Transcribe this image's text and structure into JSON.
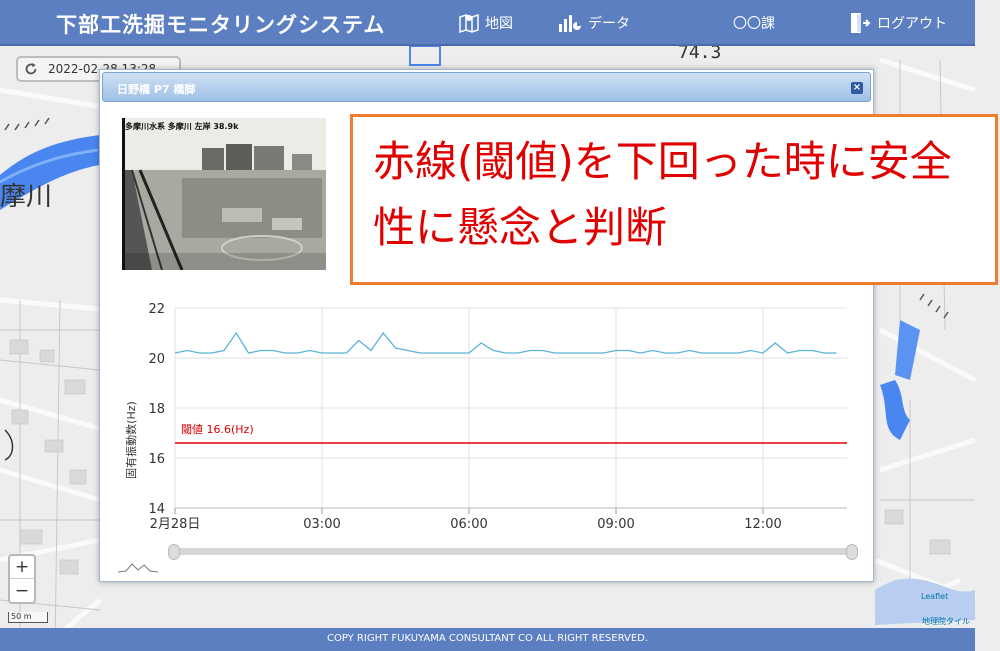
{
  "header": {
    "title": "下部工洗掘モニタリングシステム",
    "nav_map": "地図",
    "nav_data": "データ",
    "nav_dept": "〇〇課",
    "nav_logout": "ログアウト"
  },
  "map": {
    "date": "2022-02-28 13:28",
    "river_label": "摩川",
    "elevation_label": "74.3",
    "leaflet_attr": "Leaflet",
    "gsi_attr": "地理院タイル",
    "scale_label": "50 m",
    "zoom_in": "+",
    "zoom_out": "−",
    "colors": {
      "river": "#4a86f0",
      "header": "#5c7fc1"
    }
  },
  "modal": {
    "title": "日野橋 P7 橋脚",
    "close": "×",
    "camera_caption": "多摩川水系 多摩川 左岸 38.9k"
  },
  "chart_data": {
    "type": "line",
    "ylabel": "固有振動数(Hz)",
    "ylim": [
      14,
      22
    ],
    "yticks": [
      14,
      16,
      18,
      20,
      22
    ],
    "xticks": [
      "2月28日",
      "03:00",
      "06:00",
      "09:00",
      "12:00"
    ],
    "x_hours": [
      0,
      0.25,
      0.5,
      0.75,
      1,
      1.25,
      1.5,
      1.75,
      2,
      2.25,
      2.5,
      2.75,
      3,
      3.25,
      3.5,
      3.75,
      4,
      4.25,
      4.5,
      4.75,
      5,
      5.25,
      5.5,
      5.75,
      6,
      6.25,
      6.5,
      6.75,
      7,
      7.25,
      7.5,
      7.75,
      8,
      8.25,
      8.5,
      8.75,
      9,
      9.25,
      9.5,
      9.75,
      10,
      10.25,
      10.5,
      10.75,
      11,
      11.25,
      11.5,
      11.75,
      12,
      12.25,
      12.5,
      12.75,
      13,
      13.25,
      13.5
    ],
    "series": [
      {
        "values": [
          20.2,
          20.3,
          20.2,
          20.2,
          20.3,
          21.0,
          20.2,
          20.3,
          20.3,
          20.2,
          20.2,
          20.3,
          20.2,
          20.2,
          20.2,
          20.7,
          20.3,
          21.0,
          20.4,
          20.3,
          20.2,
          20.2,
          20.2,
          20.2,
          20.2,
          20.6,
          20.3,
          20.2,
          20.2,
          20.3,
          20.3,
          20.2,
          20.2,
          20.2,
          20.2,
          20.2,
          20.3,
          20.3,
          20.2,
          20.3,
          20.2,
          20.2,
          20.3,
          20.2,
          20.2,
          20.2,
          20.2,
          20.3,
          20.2,
          20.6,
          20.2,
          20.3,
          20.3,
          20.2,
          20.2
        ],
        "color": "#5ab4d6"
      }
    ],
    "threshold": {
      "value": 16.6,
      "label": "閾値 16.6(Hz)",
      "color": "#e00000"
    }
  },
  "callout": {
    "text": "赤線(閾値)を下回った時に安全性に懸念と判断"
  },
  "footer": {
    "text": "COPY RIGHT FUKUYAMA CONSULTANT CO ALL RIGHT RESERVED."
  }
}
